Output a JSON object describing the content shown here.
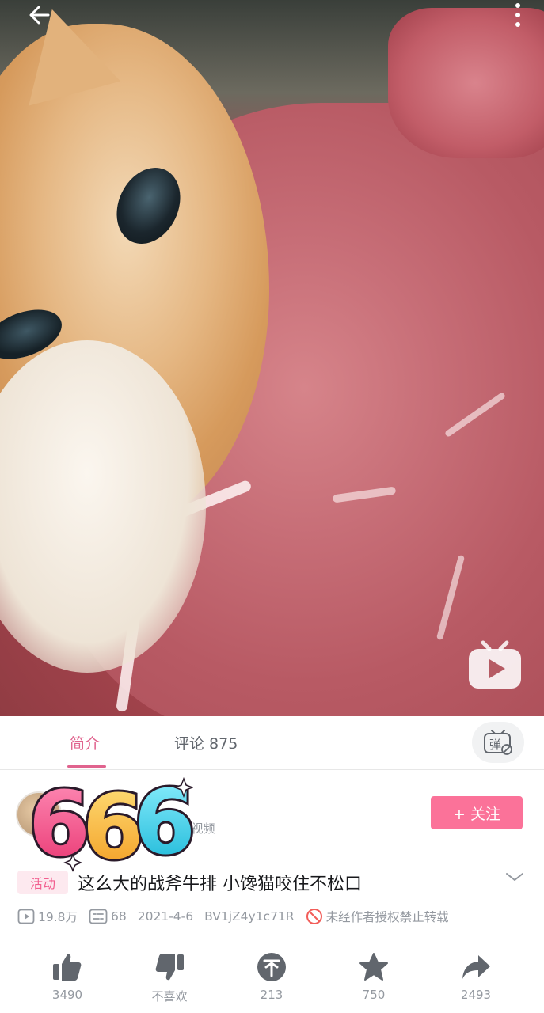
{
  "video": {
    "scene": "cat-biting-steak",
    "logo_icon": "bilibili-tv-icon"
  },
  "topbar": {
    "back_icon": "arrow-left-icon",
    "more_icon": "vertical-dots-icon"
  },
  "tabs": [
    {
      "label": "简介",
      "active": true
    },
    {
      "label": "评论 875",
      "active": false
    }
  ],
  "danmaku_toggle": {
    "icon": "danmaku-off-icon",
    "glyph": "弹"
  },
  "uploader": {
    "stats": "3视频",
    "follow_label": "+ 关注"
  },
  "sticker": {
    "text": "666"
  },
  "title": {
    "tag": "活动",
    "text": "这么大的战斧牛排 小馋猫咬住不松口"
  },
  "meta": {
    "views": "19.8万",
    "danmaku": "68",
    "date": "2021-4-6",
    "bvid": "BV1jZ4y1c71R",
    "notice": "未经作者授权禁止转载"
  },
  "actions": [
    {
      "name": "like",
      "label": "3490"
    },
    {
      "name": "dislike",
      "label": "不喜欢"
    },
    {
      "name": "coin",
      "label": "213"
    },
    {
      "name": "favorite",
      "label": "750"
    },
    {
      "name": "share",
      "label": "2493"
    }
  ],
  "colors": {
    "accent": "#fb7299",
    "tab_active": "#e0638e",
    "text_muted": "#9499a0"
  }
}
